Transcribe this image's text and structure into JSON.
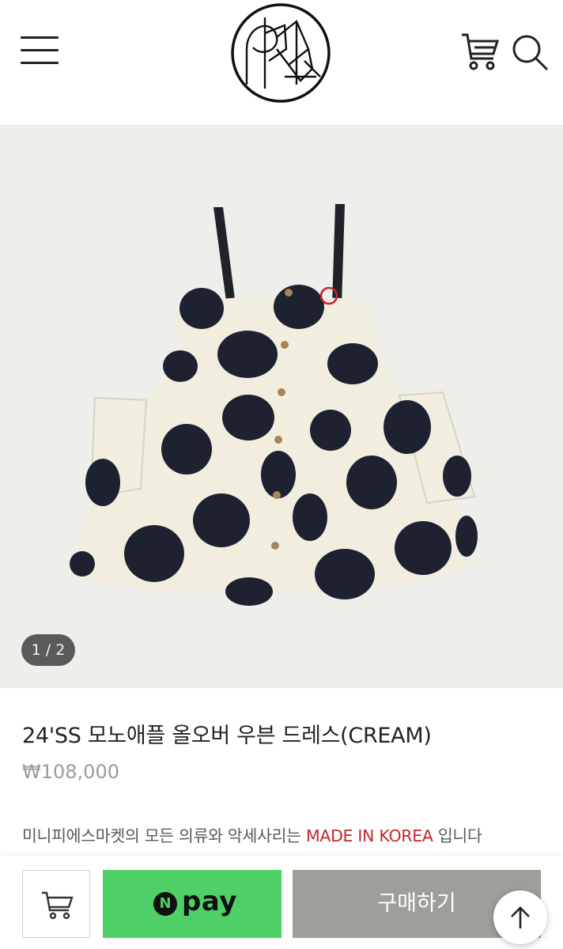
{
  "header": {
    "menu_icon": "hamburger-menu-icon",
    "logo": "brand-logo",
    "cart_icon": "cart-icon",
    "search_icon": "search-icon"
  },
  "gallery": {
    "counter": "1 / 2",
    "current": 1,
    "total": 2,
    "background": "#eeeeea"
  },
  "product": {
    "title": "24'SS 모노애플 올오버 우븐 드레스(CREAM)",
    "price": "₩108,000"
  },
  "notice": {
    "prefix": "미니피에스마켓의 모든 의류와 악세사리는 ",
    "highlight": "MADE IN KOREA",
    "suffix": " 입니다",
    "highlight_color": "#c1272d"
  },
  "bottom_bar": {
    "cart_icon": "cart-icon",
    "npay_badge": "N",
    "npay_label": "pay",
    "buy_label": "구매하기",
    "npay_color": "#4fd067",
    "buy_color": "#a09e98",
    "scroll_top_icon": "arrow-up-icon"
  }
}
